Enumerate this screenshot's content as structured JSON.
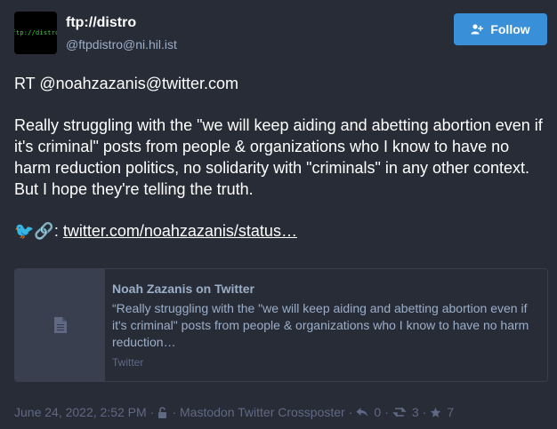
{
  "author": {
    "display_name": "ftp://distro",
    "acct": "@ftpdistro@ni.hil.ist",
    "avatar_text": "ftp://distro"
  },
  "follow_button": {
    "label": "Follow",
    "icon": "user-plus-icon",
    "color": "#3a8fd9"
  },
  "status": {
    "rt_line": "RT @noahzazanis@twitter.com",
    "body": "Really struggling with the \"we will keep aiding and abetting abortion even if it's criminal\" posts from people & organizations who I know to have no harm reduction politics, no solidarity with \"criminals\" in any other context. But I hope they're telling the truth.",
    "link_prefix": "🐦🔗: ",
    "link_text": "twitter.com/noahzazanis/status…"
  },
  "card": {
    "title": "Noah Zazanis on Twitter",
    "description": "“Really struggling with the \"we will keep aiding and abetting abortion even if it's criminal\" posts from people & organizations who I know to have no harm reduction…",
    "provider": "Twitter",
    "thumb_icon": "file-icon"
  },
  "meta": {
    "timestamp": "June 24, 2022, 2:52 PM",
    "visibility_icon": "unlock-icon",
    "application": "Mastodon Twitter Crossposter",
    "replies": "0",
    "boosts": "3",
    "favourites": "7"
  },
  "colors": {
    "background": "#282c37",
    "secondary_text": "#9baec8",
    "muted_text": "#606984",
    "border": "#393f4f"
  }
}
